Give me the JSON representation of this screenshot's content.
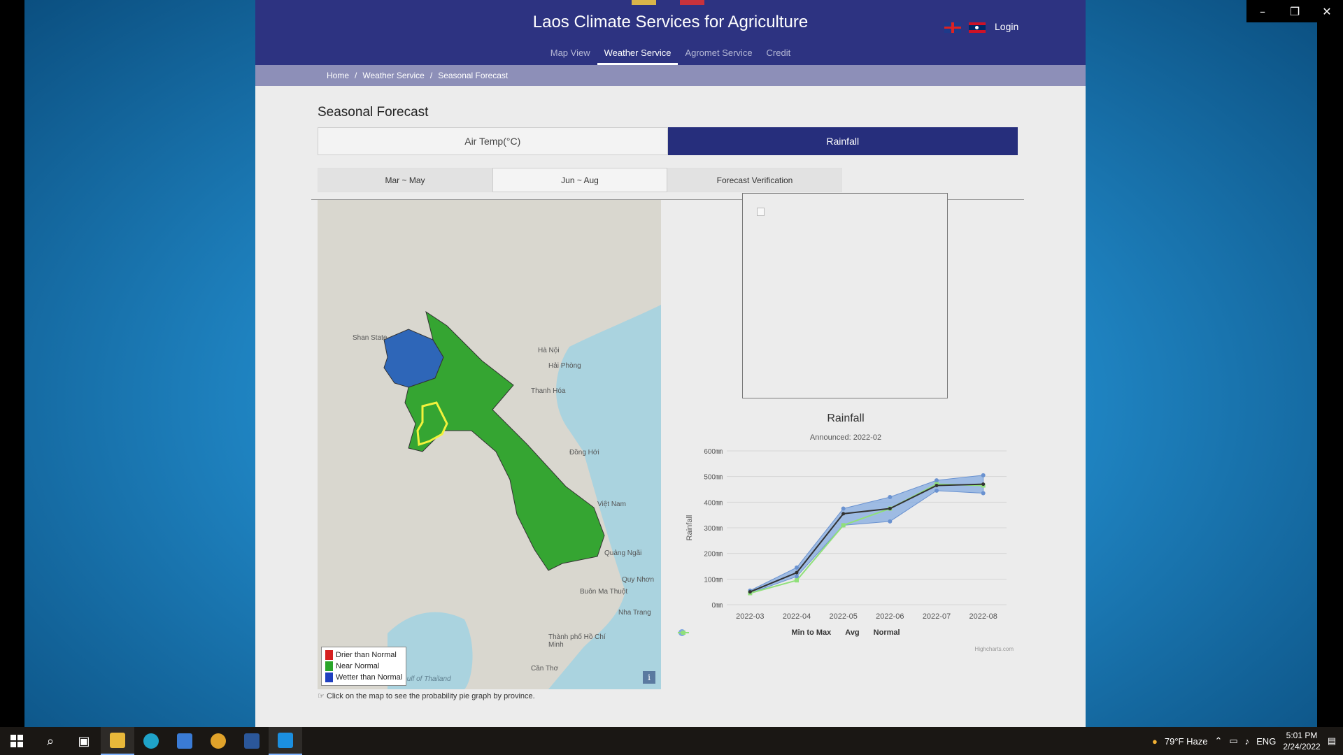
{
  "window": {
    "controls": [
      "–",
      "❐",
      "✕"
    ]
  },
  "header": {
    "title": "Laos Climate Services for Agriculture",
    "login": "Login",
    "nav": [
      "Map View",
      "Weather Service",
      "Agromet Service",
      "Credit"
    ],
    "nav_active": "Weather Service"
  },
  "breadcrumb": [
    "Home",
    "Weather Service",
    "Seasonal Forecast"
  ],
  "page_title": "Seasonal Forecast",
  "main_tabs": {
    "temp": "Air Temp(°C)",
    "rain": "Rainfall"
  },
  "sub_tabs": {
    "mar_may": "Mar ~ May",
    "jun_aug": "Jun ~ Aug",
    "verification": "Forecast Verification"
  },
  "map": {
    "legend": [
      {
        "label": "Drier than Normal",
        "color": "#d62020"
      },
      {
        "label": "Near Normal",
        "color": "#2aa52a"
      },
      {
        "label": "Wetter than Normal",
        "color": "#1f3fbf"
      }
    ],
    "place_labels": {
      "hanoi": "Hà Nội",
      "haiphong": "Hải Phòng",
      "thanhhoa": "Thanh Hóa",
      "vietnam": "Việt Nam",
      "donghoi": "Đồng Hới",
      "quangngai": "Quảng Ngãi",
      "quynhon": "Quy Nhơn",
      "buonmathuot": "Buôn Ma Thuột",
      "nhatrang": "Nha Trang",
      "hochiminh": "Thành phố Hồ Chí Minh",
      "cantho": "Cần Thơ",
      "gulf": "Gulf of Thailand",
      "shan": "Shan State"
    },
    "note": "Click on the map to see the probability pie graph by province."
  },
  "chart_data": {
    "type": "line",
    "title": "Rainfall",
    "subtitle": "Announced: 2022-02",
    "ylabel": "Rainfall",
    "xlabel": "",
    "categories": [
      "2022-03",
      "2022-04",
      "2022-05",
      "2022-06",
      "2022-07",
      "2022-08"
    ],
    "y_ticks": [
      "0㎜",
      "100㎜",
      "200㎜",
      "300㎜",
      "400㎜",
      "500㎜",
      "600㎜"
    ],
    "ylim": [
      0,
      600
    ],
    "grid": true,
    "legend_position": "bottom",
    "series": [
      {
        "name": "Min to Max",
        "kind": "range",
        "color": "#7ea6e0",
        "low": [
          45,
          110,
          310,
          325,
          445,
          435
        ],
        "high": [
          55,
          145,
          375,
          420,
          485,
          505
        ]
      },
      {
        "name": "Avg",
        "kind": "line",
        "color": "#333333",
        "values": [
          50,
          125,
          355,
          375,
          465,
          470
        ]
      },
      {
        "name": "Normal",
        "kind": "line",
        "color": "#90e07a",
        "values": [
          45,
          95,
          310,
          375,
          470,
          465
        ]
      }
    ],
    "credit": "Highcharts.com"
  },
  "taskbar": {
    "weather": "79°F  Haze",
    "lang": "ENG",
    "time": "5:01 PM",
    "date": "2/24/2022"
  }
}
